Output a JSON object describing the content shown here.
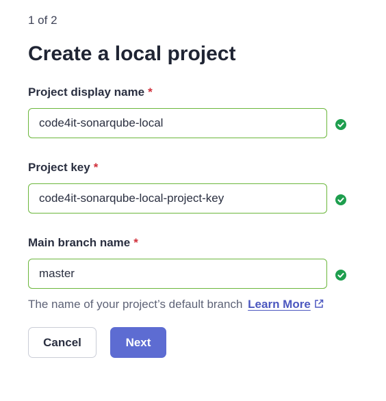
{
  "step_indicator": "1 of 2",
  "page_title": "Create a local project",
  "required_marker": "*",
  "fields": {
    "display_name": {
      "label": "Project display name",
      "value": "code4it-sonarqube-local",
      "valid": true
    },
    "project_key": {
      "label": "Project key",
      "value": "code4it-sonarqube-local-project-key",
      "valid": true
    },
    "main_branch": {
      "label": "Main branch name",
      "value": "master",
      "valid": true,
      "help_text": "The name of your project’s default branch",
      "help_link": "Learn More"
    }
  },
  "buttons": {
    "cancel": "Cancel",
    "next": "Next"
  },
  "colors": {
    "valid_border": "#6ab63a",
    "valid_icon": "#1e9e4e",
    "required": "#d02f3a",
    "primary": "#5d6cd2",
    "link": "#4b57bf"
  },
  "icons": {
    "valid": "check-circle-icon",
    "external_link": "external-link-icon"
  }
}
